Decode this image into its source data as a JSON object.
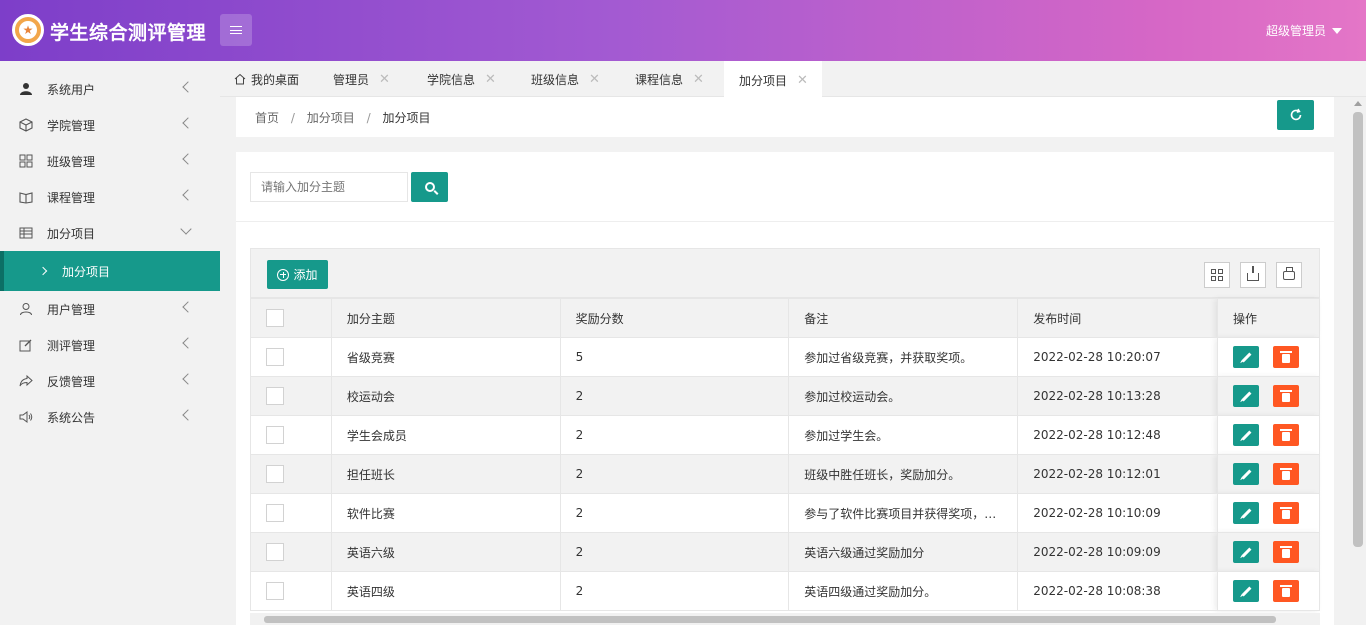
{
  "header": {
    "app_title": "学生综合测评管理",
    "user_label": "超级管理员",
    "logo_icon": "star-badge-icon",
    "colors": {
      "gradient_start": "#7d3ec9",
      "gradient_end": "#e476c7"
    }
  },
  "sidebar": {
    "items": [
      {
        "label": "系统用户",
        "icon": "user-icon"
      },
      {
        "label": "学院管理",
        "icon": "cube-icon"
      },
      {
        "label": "班级管理",
        "icon": "grid-icon"
      },
      {
        "label": "课程管理",
        "icon": "book-icon"
      },
      {
        "label": "加分项目",
        "icon": "table-icon",
        "expanded": true
      },
      {
        "label": "用户管理",
        "icon": "person-icon"
      },
      {
        "label": "测评管理",
        "icon": "edit-icon"
      },
      {
        "label": "反馈管理",
        "icon": "share-icon"
      },
      {
        "label": "系统公告",
        "icon": "speaker-icon"
      }
    ],
    "active_sub": "加分项目",
    "accent_color": "#16998b"
  },
  "tabs": [
    {
      "label": "我的桌面"
    },
    {
      "label": "管理员"
    },
    {
      "label": "学院信息"
    },
    {
      "label": "班级信息"
    },
    {
      "label": "课程信息"
    },
    {
      "label": "加分项目",
      "active": true
    }
  ],
  "breadcrumb": {
    "home": "首页",
    "level1": "加分项目",
    "level2": "加分项目",
    "separator": "/"
  },
  "search": {
    "placeholder": "请输入加分主题"
  },
  "toolbar": {
    "add_label": "添加"
  },
  "table": {
    "headers": {
      "topic": "加分主题",
      "score": "奖励分数",
      "note": "备注",
      "time": "发布时间",
      "ops": "操作"
    },
    "rows": [
      {
        "topic": "省级竞赛",
        "score": "5",
        "note": "参加过省级竞赛，并获取奖项。",
        "time": "2022-02-28 10:20:07"
      },
      {
        "topic": "校运动会",
        "score": "2",
        "note": "参加过校运动会。",
        "time": "2022-02-28 10:13:28"
      },
      {
        "topic": "学生会成员",
        "score": "2",
        "note": "参加过学生会。",
        "time": "2022-02-28 10:12:48"
      },
      {
        "topic": "担任班长",
        "score": "2",
        "note": "班级中胜任班长，奖励加分。",
        "time": "2022-02-28 10:12:01"
      },
      {
        "topic": "软件比赛",
        "score": "2",
        "note": "参与了软件比赛项目并获得奖项，…",
        "time": "2022-02-28 10:10:09"
      },
      {
        "topic": "英语六级",
        "score": "2",
        "note": "英语六级通过奖励加分",
        "time": "2022-02-28 10:09:09"
      },
      {
        "topic": "英语四级",
        "score": "2",
        "note": "英语四级通过奖励加分。",
        "time": "2022-02-28 10:08:38"
      }
    ]
  }
}
